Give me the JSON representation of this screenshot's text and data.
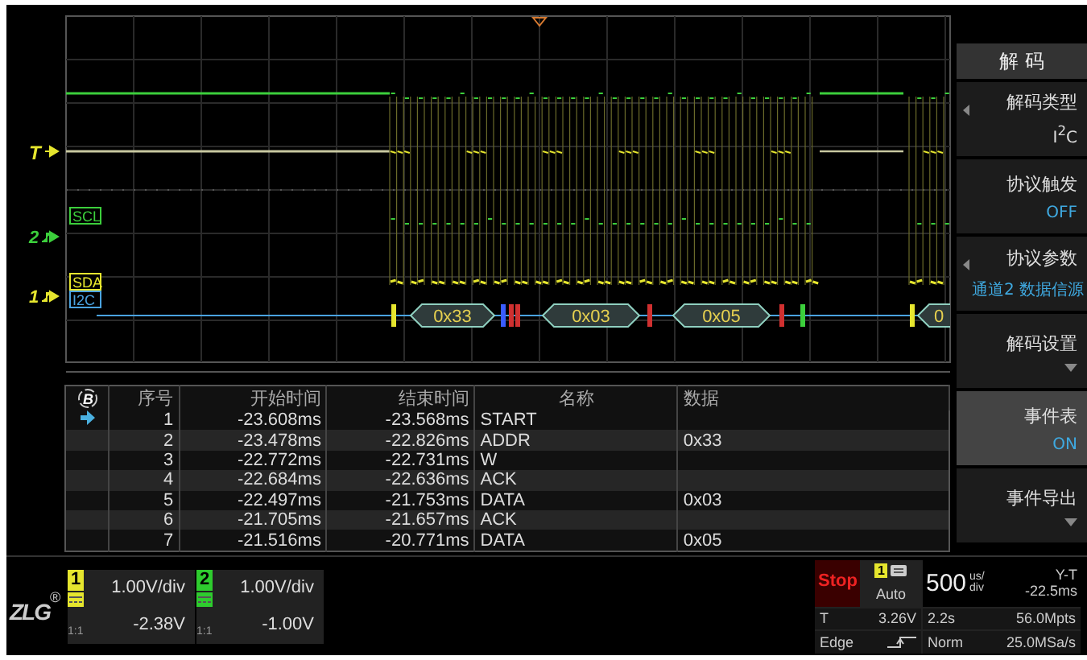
{
  "scope": {
    "trigger_label": "T",
    "channel_markers": [
      {
        "text": "2",
        "color": "#3ccf3c"
      },
      {
        "text": "1",
        "color": "#e6e62e"
      }
    ],
    "labels": [
      {
        "text": "SCL",
        "color": "#3ccf3c"
      },
      {
        "text": "SDA",
        "color": "#e6e62e"
      },
      {
        "text": "I2C",
        "color": "#4aa3e0"
      }
    ],
    "packets": [
      "0x33",
      "0x03",
      "0x05",
      "0"
    ]
  },
  "table": {
    "icon_label": "B",
    "columns": [
      "序号",
      "开始时间",
      "结束时间",
      "名称",
      "数据"
    ],
    "rows": [
      {
        "index": "1",
        "start": "-23.608ms",
        "end": "-23.568ms",
        "name": "START",
        "selected": true
      },
      {
        "index": "2",
        "start": "-23.478ms",
        "end": "-22.826ms",
        "name": "ADDR",
        "data": "0x33",
        "selected": false
      },
      {
        "index": "3",
        "start": "-22.772ms",
        "end": "-22.731ms",
        "name": "W",
        "selected": false
      },
      {
        "index": "4",
        "start": "-22.684ms",
        "end": "-22.636ms",
        "name": "ACK",
        "selected": false
      },
      {
        "index": "5",
        "start": "-22.497ms",
        "end": "-21.753ms",
        "name": "DATA",
        "data": "0x03",
        "selected": false
      },
      {
        "index": "6",
        "start": "-21.705ms",
        "end": "-21.657ms",
        "name": "ACK",
        "selected": false
      },
      {
        "index": "7",
        "start": "-21.516ms",
        "end": "-20.771ms",
        "name": "DATA",
        "data": "0x05",
        "selected": false
      }
    ]
  },
  "menu": {
    "title": "解 码",
    "items": [
      {
        "label": "解码类型",
        "kind": "value",
        "value": "I$^{2}$C",
        "has_arrow": true,
        "selected": false
      },
      {
        "label": "协议触发",
        "kind": "value",
        "value": "OFF",
        "has_arrow": false,
        "selected": false
      },
      {
        "label": "协议参数",
        "kind": "value",
        "value": "通道2 数据信源",
        "has_arrow": true,
        "selected": false
      },
      {
        "label": "解码设置",
        "kind": "submenu",
        "has_arrow": false,
        "selected": false
      },
      {
        "label": "事件表",
        "kind": "value",
        "value": "ON",
        "has_arrow": false,
        "selected": true
      },
      {
        "label": "事件导出",
        "kind": "submenu",
        "has_arrow": false,
        "selected": false
      }
    ]
  },
  "bottom": {
    "logo": "ZLG",
    "logo_mark": "®",
    "channels": [
      {
        "number": "1",
        "scale": "1.00V/div",
        "offset": "-2.38V",
        "probe": "1:1",
        "color": "#e6e62e"
      },
      {
        "number": "2",
        "scale": "1.00V/div",
        "offset": "-1.00V",
        "probe": "1:1",
        "color": "#2ecc2e"
      }
    ],
    "acquisition": {
      "status": "Stop",
      "trigger_source": "1",
      "mode": "Auto",
      "trigger_label": "T",
      "trigger_level": "3.26V",
      "trigger_type": "Edge",
      "timebase": "500",
      "timebase_unit": [
        "us/",
        "div"
      ],
      "time_mode": "Y-T",
      "delay": "-22.5ms",
      "record_time": "2.2s",
      "memory": "56.0Mpts",
      "acq_mode": "Norm",
      "sample_rate": "25.0MSa/s"
    }
  }
}
